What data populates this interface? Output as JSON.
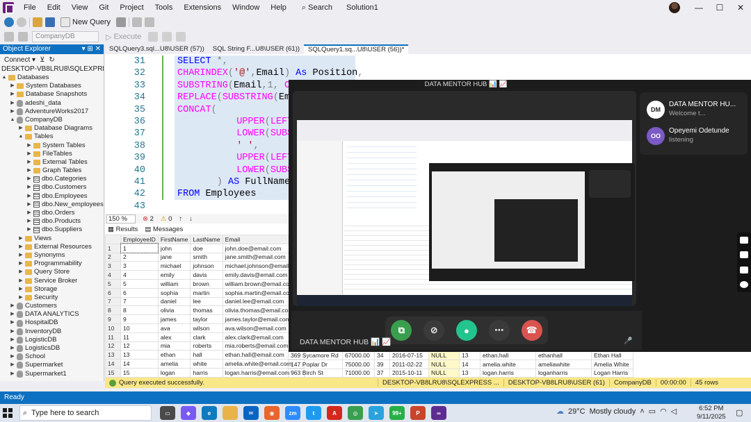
{
  "menu": [
    "File",
    "Edit",
    "View",
    "Git",
    "Project",
    "Tools",
    "Extensions",
    "Window",
    "Help"
  ],
  "search_label": "Search",
  "solution": "Solution1",
  "toolbar": {
    "new_query": "New Query",
    "database": "CompanyDB",
    "execute": "Execute"
  },
  "object_explorer": {
    "title": "Object Explorer",
    "connect": "Connect",
    "server": "DESKTOP-VB8LRU8\\SQLEXPRESS (SQ",
    "tree": [
      {
        "label": "Databases",
        "indent": 0,
        "exp": "▲",
        "icon": "fold"
      },
      {
        "label": "System Databases",
        "indent": 1,
        "exp": "▶",
        "icon": "fold"
      },
      {
        "label": "Database Snapshots",
        "indent": 1,
        "exp": "▶",
        "icon": "fold"
      },
      {
        "label": "adeshi_data",
        "indent": 1,
        "exp": "▶",
        "icon": "db"
      },
      {
        "label": "AdventureWorks2017",
        "indent": 1,
        "exp": "▶",
        "icon": "db"
      },
      {
        "label": "CompanyDB",
        "indent": 1,
        "exp": "▲",
        "icon": "db"
      },
      {
        "label": "Database Diagrams",
        "indent": 2,
        "exp": "▶",
        "icon": "fold"
      },
      {
        "label": "Tables",
        "indent": 2,
        "exp": "▲",
        "icon": "fold"
      },
      {
        "label": "System Tables",
        "indent": 3,
        "exp": "▶",
        "icon": "fold"
      },
      {
        "label": "FileTables",
        "indent": 3,
        "exp": "▶",
        "icon": "fold"
      },
      {
        "label": "External Tables",
        "indent": 3,
        "exp": "▶",
        "icon": "fold"
      },
      {
        "label": "Graph Tables",
        "indent": 3,
        "exp": "▶",
        "icon": "fold"
      },
      {
        "label": "dbo.Categories",
        "indent": 3,
        "exp": "▶",
        "icon": "tbl"
      },
      {
        "label": "dbo.Customers",
        "indent": 3,
        "exp": "▶",
        "icon": "tbl"
      },
      {
        "label": "dbo.Employees",
        "indent": 3,
        "exp": "▶",
        "icon": "tbl"
      },
      {
        "label": "dbo.New_employees",
        "indent": 3,
        "exp": "▶",
        "icon": "tbl"
      },
      {
        "label": "dbo.Orders",
        "indent": 3,
        "exp": "▶",
        "icon": "tbl"
      },
      {
        "label": "dbo.Products",
        "indent": 3,
        "exp": "▶",
        "icon": "tbl"
      },
      {
        "label": "dbo.Suppliers",
        "indent": 3,
        "exp": "▶",
        "icon": "tbl"
      },
      {
        "label": "Views",
        "indent": 2,
        "exp": "▶",
        "icon": "fold"
      },
      {
        "label": "External Resources",
        "indent": 2,
        "exp": "▶",
        "icon": "fold"
      },
      {
        "label": "Synonyms",
        "indent": 2,
        "exp": "▶",
        "icon": "fold"
      },
      {
        "label": "Programmability",
        "indent": 2,
        "exp": "▶",
        "icon": "fold"
      },
      {
        "label": "Query Store",
        "indent": 2,
        "exp": "▶",
        "icon": "fold"
      },
      {
        "label": "Service Broker",
        "indent": 2,
        "exp": "▶",
        "icon": "fold"
      },
      {
        "label": "Storage",
        "indent": 2,
        "exp": "▶",
        "icon": "fold"
      },
      {
        "label": "Security",
        "indent": 2,
        "exp": "▶",
        "icon": "fold"
      },
      {
        "label": "Customers",
        "indent": 1,
        "exp": "▶",
        "icon": "db"
      },
      {
        "label": "DATA ANALYTICS",
        "indent": 1,
        "exp": "▶",
        "icon": "db"
      },
      {
        "label": "HospitalDB",
        "indent": 1,
        "exp": "▶",
        "icon": "db"
      },
      {
        "label": "InventoryDB",
        "indent": 1,
        "exp": "▶",
        "icon": "db"
      },
      {
        "label": "LogisticDB",
        "indent": 1,
        "exp": "▶",
        "icon": "db"
      },
      {
        "label": "LogisticsDB",
        "indent": 1,
        "exp": "▶",
        "icon": "db"
      },
      {
        "label": "School",
        "indent": 1,
        "exp": "▶",
        "icon": "db"
      },
      {
        "label": "Supermarket",
        "indent": 1,
        "exp": "▶",
        "icon": "db"
      },
      {
        "label": "Supermarket1",
        "indent": 1,
        "exp": "▶",
        "icon": "db"
      }
    ]
  },
  "doc_tabs": [
    "SQLQuery3.sql...U8\\USER (57))",
    "SQL String F...U8\\USER (61))",
    "SQLQuery1.sq...U8\\USER (56))*"
  ],
  "code_lines": [
    {
      "n": "31",
      "indent": 0,
      "parts": [
        [
          "kw",
          "SELECT"
        ],
        [
          "gray",
          " *,"
        ]
      ]
    },
    {
      "n": "32",
      "indent": 0,
      "parts": [
        [
          "fn",
          "CHARINDEX"
        ],
        [
          "gray",
          "("
        ],
        [
          "str",
          "'@'"
        ],
        [
          "gray",
          ","
        ],
        [
          "plain",
          "Email"
        ],
        [
          "gray",
          ") "
        ],
        [
          "kw",
          "As"
        ],
        [
          "plain",
          " Position"
        ],
        [
          "gray",
          ","
        ]
      ]
    },
    {
      "n": "33",
      "indent": 0,
      "parts": [
        [
          "fn",
          "SUBSTRING"
        ],
        [
          "gray",
          "("
        ],
        [
          "plain",
          "Email"
        ],
        [
          "gray",
          ",1, "
        ],
        [
          "fn",
          "CH"
        ]
      ]
    },
    {
      "n": "34",
      "indent": 0,
      "parts": [
        [
          "fn",
          "REPLACE"
        ],
        [
          "gray",
          "("
        ],
        [
          "fn",
          "SUBSTRING"
        ],
        [
          "gray",
          "("
        ],
        [
          "plain",
          "Ema"
        ]
      ]
    },
    {
      "n": "35",
      "indent": 0,
      "parts": [
        [
          "fn",
          "CONCAT"
        ],
        [
          "gray",
          "("
        ]
      ]
    },
    {
      "n": "36",
      "indent": 6,
      "parts": [
        [
          "fn",
          "UPPER"
        ],
        [
          "gray",
          "("
        ],
        [
          "fn",
          "LEFT"
        ]
      ]
    },
    {
      "n": "37",
      "indent": 6,
      "parts": [
        [
          "fn",
          "LOWER"
        ],
        [
          "gray",
          "("
        ],
        [
          "fn",
          "SUBS"
        ]
      ]
    },
    {
      "n": "38",
      "indent": 6,
      "parts": [
        [
          "str",
          "' '"
        ],
        [
          "gray",
          ","
        ]
      ]
    },
    {
      "n": "39",
      "indent": 6,
      "parts": [
        [
          "fn",
          "UPPER"
        ],
        [
          "gray",
          "("
        ],
        [
          "fn",
          "LEFT"
        ]
      ]
    },
    {
      "n": "40",
      "indent": 6,
      "parts": [
        [
          "fn",
          "LOWER"
        ],
        [
          "gray",
          "("
        ],
        [
          "fn",
          "SUBS"
        ]
      ]
    },
    {
      "n": "41",
      "indent": 4,
      "parts": [
        [
          "gray",
          ") "
        ],
        [
          "kw",
          "AS"
        ],
        [
          "plain",
          " FullName"
        ]
      ]
    },
    {
      "n": "42",
      "indent": 0,
      "parts": [
        [
          "kw",
          "FROM"
        ],
        [
          "plain",
          " Employees"
        ]
      ]
    },
    {
      "n": "43",
      "indent": 0,
      "parts": []
    }
  ],
  "editor_status": {
    "zoom": "150 %",
    "errors": "2",
    "warnings": "0"
  },
  "results_tabs": [
    "Results",
    "Messages"
  ],
  "results": {
    "left_headers": [
      "",
      "EmployeeID",
      "FirstName",
      "LastName",
      "Email"
    ],
    "left_rows": [
      [
        "1",
        "1",
        "john",
        "doe",
        "john.doe@email.com"
      ],
      [
        "2",
        "2",
        "jane",
        "smith",
        "jane.smith@email.com"
      ],
      [
        "3",
        "3",
        "michael",
        "johnson",
        "michael.johnson@email.com"
      ],
      [
        "4",
        "4",
        "emily",
        "davis",
        "emily.davis@email.com"
      ],
      [
        "5",
        "5",
        "william",
        "brown",
        "william.brown@email.com"
      ],
      [
        "6",
        "6",
        "sophia",
        "martin",
        "sophia.martin@email.com"
      ],
      [
        "7",
        "7",
        "daniel",
        "lee",
        "daniel.lee@email.com"
      ],
      [
        "8",
        "8",
        "olivia",
        "thomas",
        "olivia.thomas@email.com"
      ],
      [
        "9",
        "9",
        "james",
        "taylor",
        "james.taylor@email.com"
      ],
      [
        "10",
        "10",
        "ava",
        "wilson",
        "ava.wilson@email.com"
      ],
      [
        "11",
        "11",
        "alex",
        "clark",
        "alex.clark@email.com"
      ],
      [
        "12",
        "12",
        "mia",
        "roberts",
        "mia.roberts@email.com"
      ],
      [
        "13",
        "13",
        "ethan",
        "hall",
        "ethan.hall@email.com"
      ],
      [
        "14",
        "14",
        "amelia",
        "white",
        "amelia.white@email.com"
      ],
      [
        "15",
        "15",
        "logan",
        "harris",
        "logan.harris@email.com"
      ]
    ],
    "right_rows": [
      [
        "369 Sycamore Rd",
        "67000.00",
        "34",
        "2016-07-15",
        "NULL",
        "13",
        "ethan.hall",
        "ethanhall",
        "Ethan Hall"
      ],
      [
        "147 Poplar Dr",
        "75000.00",
        "39",
        "2011-02-22",
        "NULL",
        "14",
        "amelia.white",
        "ameliawhite",
        "Amelia White"
      ],
      [
        "963 Birch St",
        "71000.00",
        "37",
        "2015-10-11",
        "NULL",
        "13",
        "logan.harris",
        "loganharris",
        "Logan Harris"
      ]
    ]
  },
  "query_status": {
    "message": "Query executed successfully.",
    "server": "DESKTOP-VB8LRU8\\SQLEXPRESS ...",
    "user": "DESKTOP-VB8LRU8\\USER (61)",
    "db": "CompanyDB",
    "time": "00:00:00",
    "rows": "45 rows"
  },
  "app_status": "Ready",
  "taskbar": {
    "search_placeholder": "Type here to search",
    "weather": "29°C",
    "weather_desc": "Mostly cloudy",
    "time": "6:52 PM",
    "date": "9/11/2025",
    "apps": [
      {
        "name": "task-view",
        "color": "#4a4a4a",
        "label": "▭"
      },
      {
        "name": "copilot",
        "color": "#7a5af5",
        "label": "◆"
      },
      {
        "name": "edge",
        "color": "#0f7bbf",
        "label": "e"
      },
      {
        "name": "file-explorer",
        "color": "#e8b44a",
        "label": ""
      },
      {
        "name": "mail",
        "color": "#0a64c2",
        "label": "✉"
      },
      {
        "name": "firefox",
        "color": "#e8662b",
        "label": "◉"
      },
      {
        "name": "zoom",
        "color": "#2d8cff",
        "label": "zm"
      },
      {
        "name": "twitter",
        "color": "#1d9bf0",
        "label": "t"
      },
      {
        "name": "acrobat",
        "color": "#d4281d",
        "label": "A"
      },
      {
        "name": "chrome",
        "color": "#3a9e4f",
        "label": "◎"
      },
      {
        "name": "telegram",
        "color": "#2aa3dd",
        "label": "➤"
      },
      {
        "name": "whatsapp",
        "color": "#25b045",
        "label": "99+"
      },
      {
        "name": "powerpoint",
        "color": "#c8452a",
        "label": "P"
      },
      {
        "name": "visual-studio",
        "color": "#5c2d91",
        "label": "∞"
      }
    ]
  },
  "meeting": {
    "title": "DATA MENTOR HUB",
    "brand_footer": "DATA MENTOR HUB",
    "participants": [
      {
        "name": "DATA MENTOR HU...",
        "status": "Welcome t...",
        "initials": "DM",
        "color": "#ffffff"
      },
      {
        "name": "Opeyemi Odetunde",
        "status": "listening",
        "initials": "OO",
        "color": "#7b5ac6"
      }
    ]
  }
}
